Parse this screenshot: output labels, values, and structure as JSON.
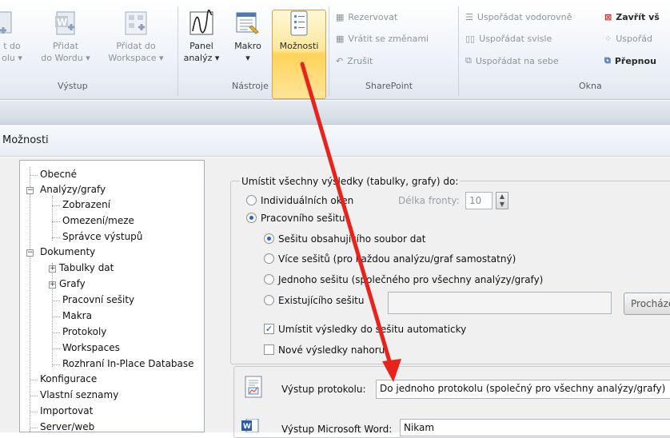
{
  "ribbon": {
    "vystup_group": {
      "name": "Výstup",
      "btn1": {
        "line1": "t do",
        "line2": "olu ▾"
      },
      "btn2": {
        "line1": "Přidat",
        "line2": "do Wordu ▾"
      },
      "btn3": {
        "line1": "Přidat do",
        "line2": "Workspace ▾"
      }
    },
    "nastroje_group": {
      "name": "Nástroje",
      "panel": {
        "line1": "Panel",
        "line2": "analýz ▾"
      },
      "makro": {
        "line1": "Makro",
        "line2": "▾"
      },
      "moznosti": {
        "line1": "Možnosti"
      }
    },
    "sharepoint_group": {
      "name": "SharePoint",
      "items": [
        "Rezervovat",
        "Vrátit se změnami",
        "Zrušit"
      ]
    },
    "okna_group": {
      "name": "Okna",
      "items": [
        "Uspořádat vodorovně",
        "Uspořádat svisle",
        "Uspořádat na sebe"
      ],
      "items2": [
        "Zavřít vš",
        "Uspořád",
        "Přepnou"
      ]
    }
  },
  "dialog": {
    "title": "Možnosti"
  },
  "tree": {
    "items": [
      {
        "label": "Obecné"
      },
      {
        "label": "Analýzy/grafy"
      },
      {
        "label": "Zobrazení"
      },
      {
        "label": "Omezení/meze"
      },
      {
        "label": "Správce výstupů"
      },
      {
        "label": "Dokumenty"
      },
      {
        "label": "Tabulky dat"
      },
      {
        "label": "Grafy"
      },
      {
        "label": "Pracovní sešity"
      },
      {
        "label": "Makra"
      },
      {
        "label": "Protokoly"
      },
      {
        "label": "Workspaces"
      },
      {
        "label": "Rozhraní In-Place Database"
      },
      {
        "label": "Konfigurace"
      },
      {
        "label": "Vlastní seznamy"
      },
      {
        "label": "Importovat"
      },
      {
        "label": "Server/web"
      }
    ]
  },
  "panel": {
    "heading": "Umístit všechny výsledky (tabulky, grafy) do:",
    "opt_individual": "Individuálních oken",
    "queue_label": "Délka fronty:",
    "queue_value": "10",
    "opt_workbook": "Pracovního sešitu",
    "opt_data_book": "Sešitu obsahujícího soubor dat",
    "opt_multi": "Více sešitů (pro každou analýzu/graf samostatný)",
    "opt_single": "Jednoho sešitu (společného pro všechny analýzy/grafy)",
    "opt_existing": "Existujícího sešitu",
    "browse": "Procházet",
    "chk_auto": "Umístit výsledky do sešitu automaticky",
    "chk_top": "Nové výsledky nahoru",
    "report_label": "Výstup protokolu:",
    "report_value": "Do jednoho protokolu (společný pro všechny analýzy/grafy)",
    "word_label": "Výstup Microsoft Word:",
    "word_value": "Nikam"
  },
  "colors": {
    "arrow": "#e8231c",
    "highlight": "#ffd35a"
  }
}
